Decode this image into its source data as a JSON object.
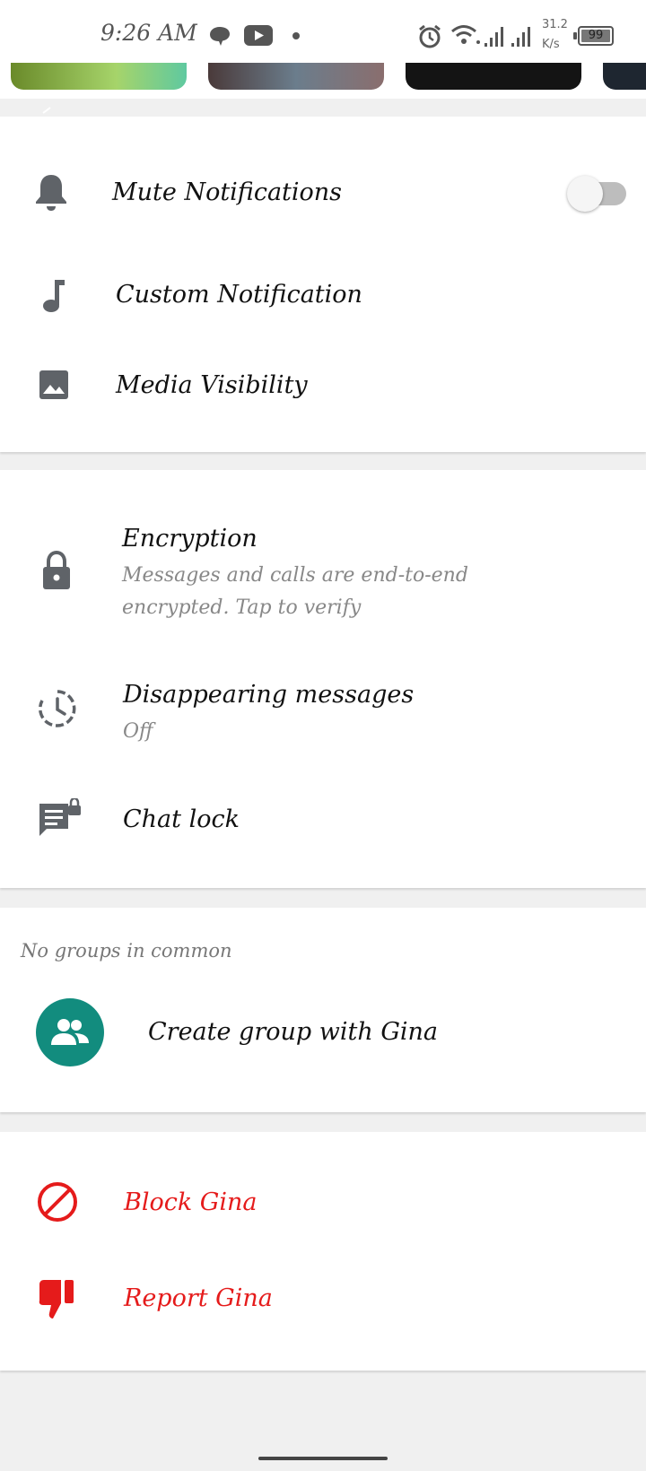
{
  "status_bar": {
    "time": "9:26 AM",
    "net_speed_value": "31.2",
    "net_speed_unit": "K/s",
    "battery": "99"
  },
  "notifications": {
    "mute": {
      "label": "Mute Notifications",
      "enabled": false
    },
    "custom": {
      "label": "Custom Notification"
    },
    "media": {
      "label": "Media Visibility"
    }
  },
  "privacy": {
    "encryption": {
      "title": "Encryption",
      "line1": "Messages and calls are end-to-end",
      "line2": "encrypted. Tap to verify"
    },
    "disappearing": {
      "title": "Disappearing messages",
      "value": "Off"
    },
    "chat_lock": {
      "label": "Chat lock"
    }
  },
  "groups": {
    "title": "No groups in common",
    "create_label": "Create group with Gina"
  },
  "actions": {
    "block": "Block Gina",
    "report": "Report Gina"
  },
  "colors": {
    "accent_green": "#128c7e",
    "danger_red": "#e51b1b",
    "icon_gray": "#5f6368"
  }
}
